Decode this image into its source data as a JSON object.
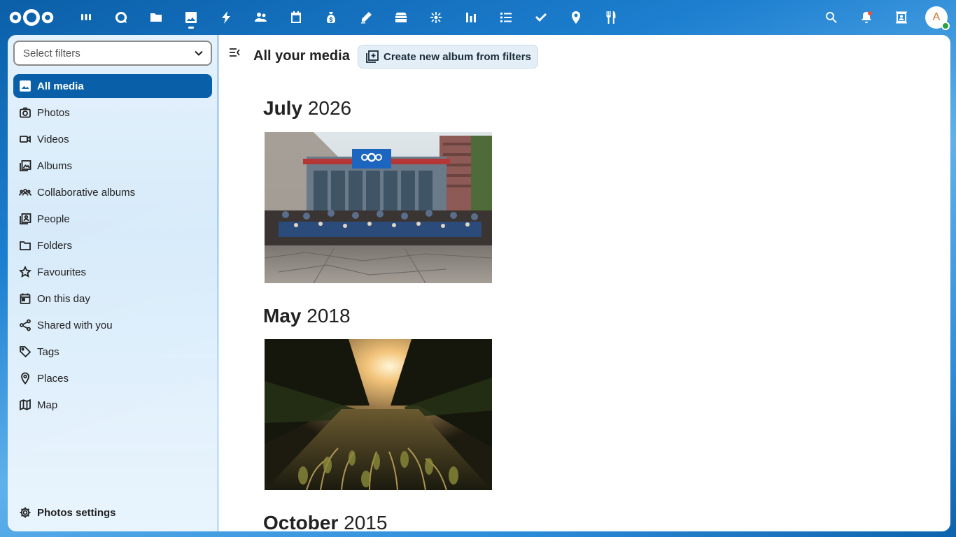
{
  "header": {
    "logo": "nextcloud-logo",
    "apps": [
      {
        "name": "dashboard-icon"
      },
      {
        "name": "talk-icon"
      },
      {
        "name": "files-icon"
      },
      {
        "name": "photos-icon",
        "active": true
      },
      {
        "name": "activity-icon"
      },
      {
        "name": "contacts-icon"
      },
      {
        "name": "calendar-icon"
      },
      {
        "name": "cospend-icon"
      },
      {
        "name": "notes-icon"
      },
      {
        "name": "deck-icon"
      },
      {
        "name": "news-icon"
      },
      {
        "name": "analytics-icon"
      },
      {
        "name": "tasks-list-icon"
      },
      {
        "name": "tasks-icon"
      },
      {
        "name": "maps-icon"
      },
      {
        "name": "cookbook-icon"
      }
    ],
    "avatar_initial": "A"
  },
  "sidebar": {
    "filter_placeholder": "Select filters",
    "items": [
      {
        "label": "All media",
        "icon": "image-icon",
        "active": true
      },
      {
        "label": "Photos",
        "icon": "camera-icon"
      },
      {
        "label": "Videos",
        "icon": "video-icon"
      },
      {
        "label": "Albums",
        "icon": "albums-icon"
      },
      {
        "label": "Collaborative albums",
        "icon": "group-icon"
      },
      {
        "label": "People",
        "icon": "people-icon"
      },
      {
        "label": "Folders",
        "icon": "folder-icon"
      },
      {
        "label": "Favourites",
        "icon": "star-icon"
      },
      {
        "label": "On this day",
        "icon": "calendar-day-icon"
      },
      {
        "label": "Shared with you",
        "icon": "share-icon"
      },
      {
        "label": "Tags",
        "icon": "tag-icon"
      },
      {
        "label": "Places",
        "icon": "map-marker-icon"
      },
      {
        "label": "Map",
        "icon": "map-icon"
      }
    ],
    "settings_label": "Photos settings"
  },
  "main": {
    "title": "All your media",
    "create_button": "Create new album from filters",
    "sections": [
      {
        "month": "July",
        "year": "2026"
      },
      {
        "month": "May",
        "year": "2018"
      },
      {
        "month": "October",
        "year": "2015"
      }
    ]
  },
  "colors": {
    "accent": "#0a60a8",
    "header_gradient": "#1d7fd0"
  }
}
